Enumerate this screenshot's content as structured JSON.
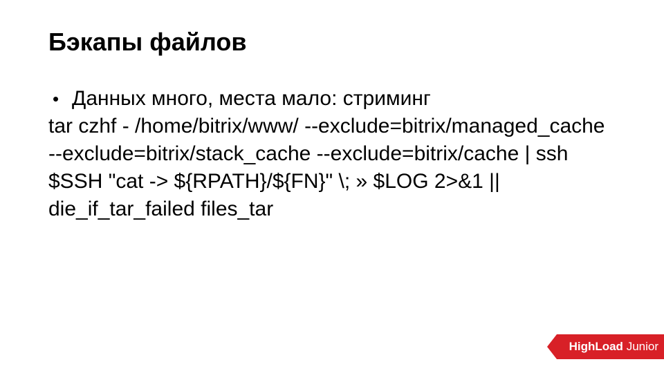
{
  "title": "Бэкапы файлов",
  "bullet": "Данных много, места мало: стриминг",
  "command": "tar czhf - /home/bitrix/www/ --exclude=bitrix/managed_cache --exclude=bitrix/stack_cache --exclude=bitrix/cache | ssh $SSH \"cat -> ${RPATH}/${FN}\"  \\; » $LOG 2>&1 || die_if_tar_failed files_tar",
  "logo": {
    "bold": "HighLoad",
    "light": "Junior"
  },
  "colors": {
    "accent": "#d82027"
  }
}
